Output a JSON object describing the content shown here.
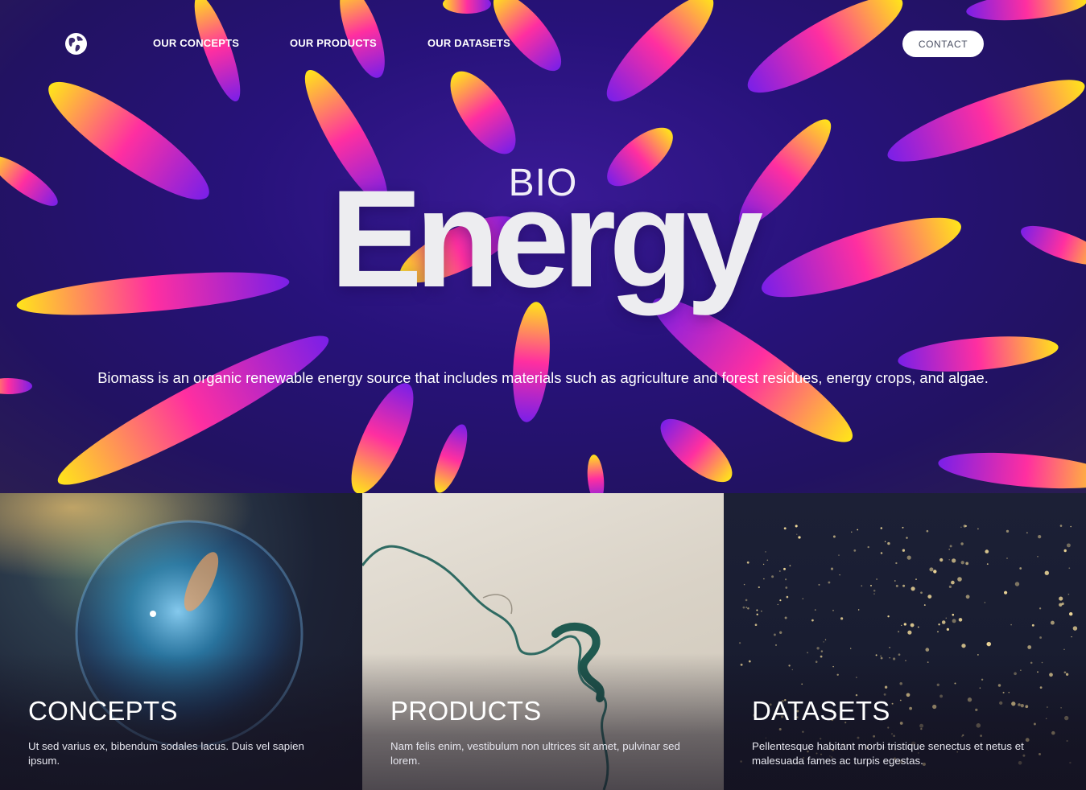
{
  "nav": {
    "logo_icon": "globe-icon",
    "links": [
      "OUR CONCEPTS",
      "OUR PRODUCTS",
      "OUR DATASETS"
    ],
    "contact_label": "CONTACT"
  },
  "hero": {
    "title_small": "BIO",
    "title_large": "Energy",
    "description": "Biomass is an organic renewable energy source that includes materials such as agriculture and forest residues, energy crops, and algae."
  },
  "cards": [
    {
      "title": "CONCEPTS",
      "text": "Ut sed varius ex, bibendum sodales lacus. Duis vel sapien ipsum."
    },
    {
      "title": "PRODUCTS",
      "text": "Nam felis enim, vestibulum non ultrices sit amet, pulvinar sed lorem."
    },
    {
      "title": "DATASETS",
      "text": "Pellentesque habitant morbi tristique senectus et netus et malesuada fames ac turpis egestas."
    }
  ],
  "colors": {
    "hero_background": "#27127a",
    "petal_yellow": "#f7e11a",
    "petal_pink": "#ff2fa0",
    "petal_violet": "#7a1fe8",
    "contact_button": "#ffffff"
  }
}
